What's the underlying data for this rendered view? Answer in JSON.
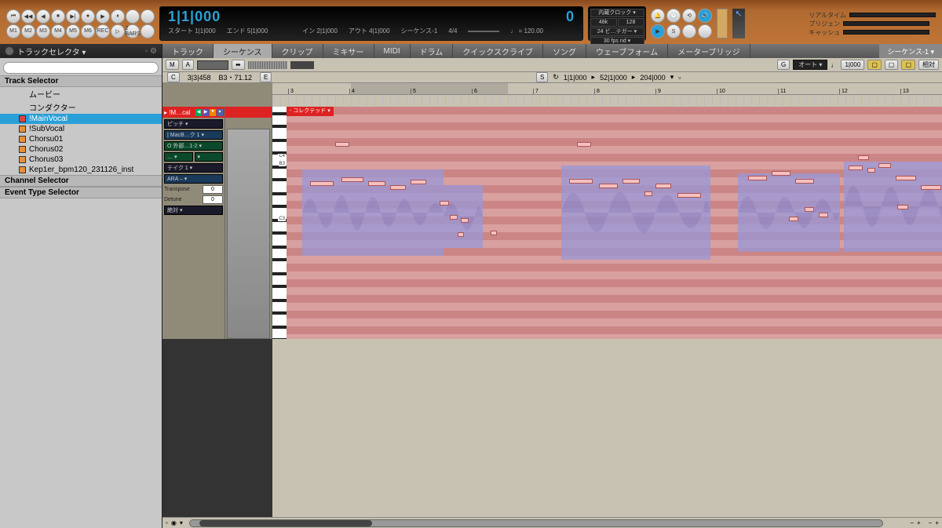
{
  "transport_icons": [
    "⏮",
    "◀◀",
    "◀",
    "⏹",
    "▶|",
    "●",
    "▶",
    "⏸",
    "",
    "",
    "M1",
    "M2",
    "M3",
    "M4",
    "M5",
    "M6",
    "REC",
    "▷",
    "2 BARS",
    ""
  ],
  "counter": {
    "main_pos": "1|1|000",
    "main_sub": "0",
    "start_lbl": "スタート",
    "start_val": "1|1|000",
    "end_lbl": "エンド",
    "end_val": "5|1|000",
    "in_lbl": "イン",
    "in_val": "2|1|000",
    "out_lbl": "アウト",
    "out_val": "4|1|000",
    "seq_lbl": "シーケンス-1",
    "sig": "4/4",
    "tempo": "120.00"
  },
  "settings": {
    "r0a": "内蔵クロック ▾",
    "r1a": "48k",
    "r1b": "128",
    "r2a": "24 ビ…テガー ▾",
    "r3a": "30 fps nd ▾"
  },
  "status": {
    "l1": "リアルタイム",
    "l2": "プリジェン",
    "l3": "キャッシュ"
  },
  "sidebar": {
    "title": "トラックセレクタ ▾",
    "search_ph": "",
    "sections": [
      "Track Selector",
      "Channel Selector",
      "Event Type Selector"
    ],
    "tracks": [
      {
        "label": "ムービー",
        "icon": ""
      },
      {
        "label": "コンダクター",
        "icon": ""
      },
      {
        "label": "!MainVocal",
        "icon": "red",
        "sel": true
      },
      {
        "label": "!SubVocal",
        "icon": "org"
      },
      {
        "label": "Chorsu01",
        "icon": "org"
      },
      {
        "label": "Chorus02",
        "icon": "org"
      },
      {
        "label": "Chorus03",
        "icon": "org"
      },
      {
        "label": "Kep1er_bpm120_231126_inst",
        "icon": "org"
      }
    ]
  },
  "tabs": [
    "トラック",
    "シーケンス",
    "クリップ",
    "ミキサー",
    "MIDI",
    "ドラム",
    "クイックスクライブ",
    "ソング",
    "ウェーブフォーム",
    "メーターブリッジ"
  ],
  "tab_selected": 1,
  "tab_right": "シーケンス-1 ▾",
  "toolbar2": {
    "m": "M",
    "a": "A",
    "g": "G",
    "auto": "オート ▾",
    "beat": "1|000",
    "rel": "相対"
  },
  "info": {
    "cl": "C",
    "pos": "3|3|458",
    "note": "B3・71.12",
    "e": "E",
    "s": "S",
    "s1": "1|1|000",
    "s2": "52|1|000",
    "s3": "204|000"
  },
  "ruler_nums": [
    "3",
    "4",
    "5",
    "6",
    "7",
    "8",
    "9",
    "10",
    "11",
    "12",
    "13"
  ],
  "track_header": {
    "title": "▸ !M…cal",
    "sel1": "ピッチ ▾",
    "sel2": "| MacB…ク 1 ▾",
    "sel3": "O 外部…1-2 ▾",
    "sel4": "… ▾",
    "sel5": "テイク 1 ▾",
    "sel6": "ARA –  ▾",
    "transpose_lbl": "Transpose",
    "transpose_val": "0",
    "detune_lbl": "Detune",
    "detune_val": "0",
    "sel7": "絶対 ▾"
  },
  "piano": {
    "c3": "C3",
    "c4": "C4",
    "b3": "B3"
  },
  "clip_label": "- コレクテッド ▾"
}
